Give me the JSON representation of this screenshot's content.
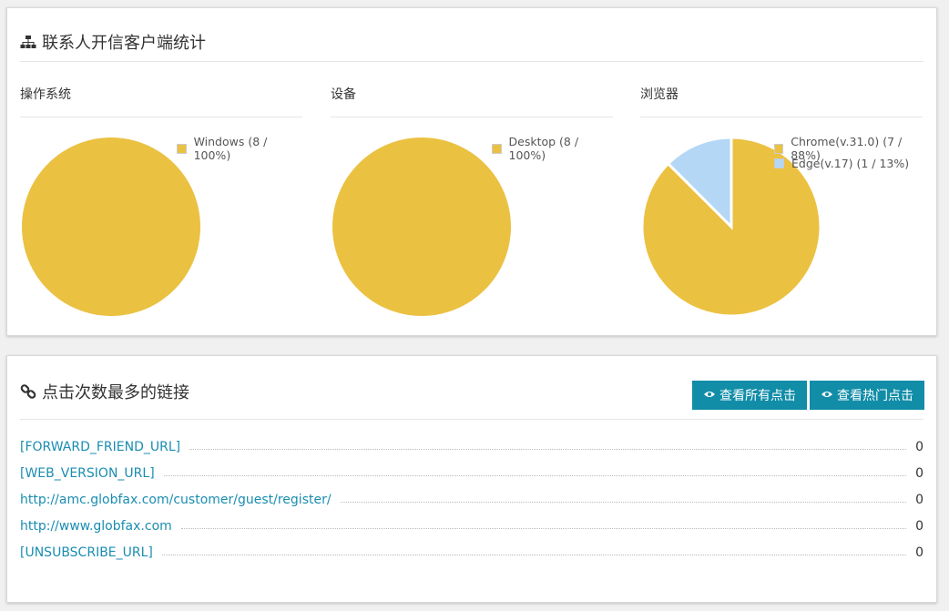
{
  "client_stats": {
    "title": "联系人开信客户端统计",
    "icon": "sitemap-icon",
    "sections": [
      {
        "title": "操作系统",
        "legend": [
          {
            "label": "Windows (8 / 100%)",
            "color": "#ebc142"
          }
        ]
      },
      {
        "title": "设备",
        "legend": [
          {
            "label": "Desktop (8 / 100%)",
            "color": "#ebc142"
          }
        ]
      },
      {
        "title": "浏览器",
        "legend": [
          {
            "label": "Chrome(v.31.0) (7 / 88%)",
            "color": "#ebc142"
          },
          {
            "label": "Edge(v.17) (1 / 13%)",
            "color": "#b3d7f5"
          }
        ]
      }
    ]
  },
  "chart_data": [
    {
      "type": "pie",
      "title": "操作系统",
      "categories": [
        "Windows"
      ],
      "values": [
        8
      ],
      "colors": [
        "#ebc142"
      ]
    },
    {
      "type": "pie",
      "title": "设备",
      "categories": [
        "Desktop"
      ],
      "values": [
        8
      ],
      "colors": [
        "#ebc142"
      ]
    },
    {
      "type": "pie",
      "title": "浏览器",
      "categories": [
        "Chrome(v.31.0)",
        "Edge(v.17)"
      ],
      "values": [
        7,
        1
      ],
      "colors": [
        "#ebc142",
        "#b3d7f5"
      ]
    }
  ],
  "top_links": {
    "title": "点击次数最多的链接",
    "icon": "link-icon",
    "buttons": {
      "view_all": "查看所有点击",
      "view_top": "查看热门点击"
    },
    "rows": [
      {
        "url": "[FORWARD_FRIEND_URL]",
        "count": "0"
      },
      {
        "url": "[WEB_VERSION_URL]",
        "count": "0"
      },
      {
        "url": "http://amc.globfax.com/customer/guest/register/",
        "count": "0"
      },
      {
        "url": "http://www.globfax.com",
        "count": "0"
      },
      {
        "url": "[UNSUBSCRIBE_URL]",
        "count": "0"
      }
    ]
  },
  "colors": {
    "accent": "#118da8",
    "link": "#1a8db0",
    "pie_primary": "#ebc142",
    "pie_secondary": "#b3d7f5"
  }
}
